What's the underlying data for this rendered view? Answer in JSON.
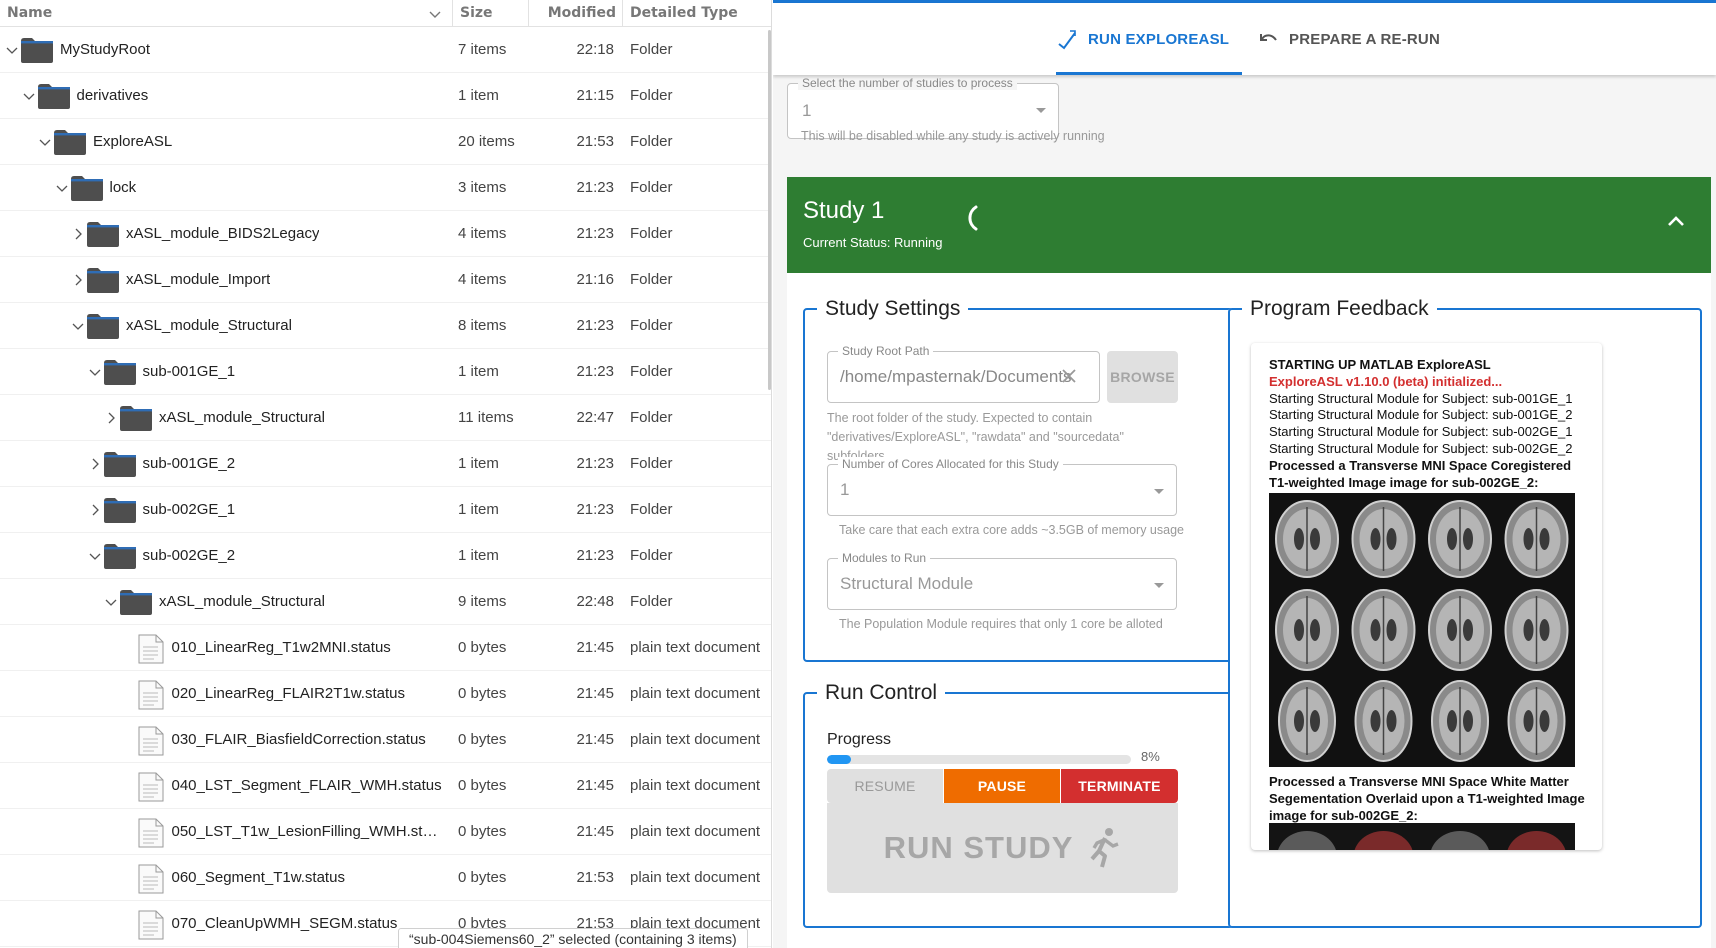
{
  "file_manager": {
    "columns": {
      "name": "Name",
      "size": "Size",
      "modified": "Modified",
      "type": "Detailed Type"
    },
    "rows": [
      {
        "name": "MyStudyRoot",
        "size": "7 items",
        "modified": "22:18",
        "type": "Folder"
      },
      {
        "name": "derivatives",
        "size": "1 item",
        "modified": "21:15",
        "type": "Folder"
      },
      {
        "name": "ExploreASL",
        "size": "20 items",
        "modified": "21:53",
        "type": "Folder"
      },
      {
        "name": "lock",
        "size": "3 items",
        "modified": "21:23",
        "type": "Folder"
      },
      {
        "name": "xASL_module_BIDS2Legacy",
        "size": "4 items",
        "modified": "21:23",
        "type": "Folder"
      },
      {
        "name": "xASL_module_Import",
        "size": "4 items",
        "modified": "21:16",
        "type": "Folder"
      },
      {
        "name": "xASL_module_Structural",
        "size": "8 items",
        "modified": "21:23",
        "type": "Folder"
      },
      {
        "name": "sub-001GE_1",
        "size": "1 item",
        "modified": "21:23",
        "type": "Folder"
      },
      {
        "name": "xASL_module_Structural",
        "size": "11 items",
        "modified": "22:47",
        "type": "Folder"
      },
      {
        "name": "sub-001GE_2",
        "size": "1 item",
        "modified": "21:23",
        "type": "Folder"
      },
      {
        "name": "sub-002GE_1",
        "size": "1 item",
        "modified": "21:23",
        "type": "Folder"
      },
      {
        "name": "sub-002GE_2",
        "size": "1 item",
        "modified": "21:23",
        "type": "Folder"
      },
      {
        "name": "xASL_module_Structural",
        "size": "9 items",
        "modified": "22:48",
        "type": "Folder"
      },
      {
        "name": "010_LinearReg_T1w2MNI.status",
        "size": "0 bytes",
        "modified": "21:45",
        "type": "plain text document"
      },
      {
        "name": "020_LinearReg_FLAIR2T1w.status",
        "size": "0 bytes",
        "modified": "21:45",
        "type": "plain text document"
      },
      {
        "name": "030_FLAIR_BiasfieldCorrection.status",
        "size": "0 bytes",
        "modified": "21:45",
        "type": "plain text document"
      },
      {
        "name": "040_LST_Segment_FLAIR_WMH.status",
        "size": "0 bytes",
        "modified": "21:45",
        "type": "plain text document"
      },
      {
        "name": "050_LST_T1w_LesionFilling_WMH.st…",
        "size": "0 bytes",
        "modified": "21:45",
        "type": "plain text document"
      },
      {
        "name": "060_Segment_T1w.status",
        "size": "0 bytes",
        "modified": "21:53",
        "type": "plain text document"
      },
      {
        "name": "070_CleanUpWMH_SEGM.status",
        "size": "0 bytes",
        "modified": "21:53",
        "type": "plain text document"
      }
    ],
    "status_bar": "“sub-004Siemens60_2” selected  (containing 3 items)"
  },
  "app": {
    "tabs": {
      "run": "RUN EXPLOREASL",
      "rerun": "PREPARE A RE-RUN"
    },
    "studies": {
      "label": "Select the number of studies to process",
      "value": "1",
      "helper": "This will be disabled while any study is actively running"
    },
    "study": {
      "title": "Study 1",
      "status": "Current Status: Running",
      "header_color": "#2e7d32"
    },
    "settings": {
      "legend": "Study Settings",
      "path_label": "Study Root Path",
      "path_value": "/home/mpasternak/Documents",
      "browse": "BROWSE",
      "path_helper": "The root folder of the study. Expected to contain \"derivatives/ExploreASL\", \"rawdata\" and \"sourcedata\" subfolders",
      "cores_label": "Number of Cores Allocated for this Study",
      "cores_value": "1",
      "cores_helper": "Take care that each extra core adds ~3.5GB of memory usage",
      "modules_label": "Modules to Run",
      "modules_value": "Structural Module",
      "modules_helper": "The Population Module requires that only 1 core be alloted"
    },
    "run_control": {
      "legend": "Run Control",
      "progress_label": "Progress",
      "progress_pct_text": "8%",
      "progress_fraction": 0.08,
      "resume": "RESUME",
      "pause": "PAUSE",
      "terminate": "TERMINATE",
      "run_study": "RUN STUDY"
    },
    "feedback": {
      "legend": "Program Feedback",
      "lines": [
        {
          "text": "STARTING UP MATLAB ExploreASL",
          "style": "bold"
        },
        {
          "text": "ExploreASL v1.10.0 (beta) initialized...",
          "style": "red"
        },
        {
          "text": "Starting Structural Module for Subject: sub-001GE_1",
          "style": "normal"
        },
        {
          "text": "Starting Structural Module for Subject: sub-001GE_2",
          "style": "normal"
        },
        {
          "text": "Starting Structural Module for Subject: sub-002GE_1",
          "style": "normal"
        },
        {
          "text": "Starting Structural Module for Subject: sub-002GE_2",
          "style": "normal"
        },
        {
          "text": "Processed a Transverse MNI Space Coregistered T1-weighted Image image for sub-002GE_2:",
          "style": "bold"
        }
      ],
      "caption2": "Processed a Transverse MNI Space White Matter Segementation Overlaid upon a T1-weighted Image image for sub-002GE_2:"
    },
    "colors": {
      "accent": "#1976d2",
      "pause": "#ef6c00",
      "terminate": "#d32f2f",
      "progress": "#2196f3"
    }
  }
}
